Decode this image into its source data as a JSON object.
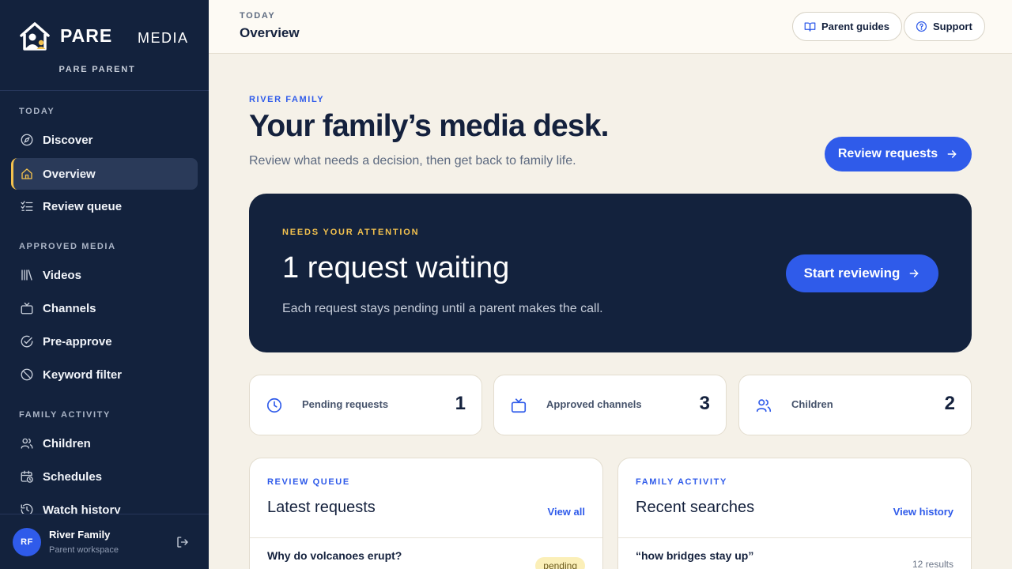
{
  "brand": {
    "name": "PARE",
    "product": "MEDIA",
    "subtitle": "PARE PARENT"
  },
  "sidebar": {
    "sections": [
      {
        "label": "TODAY"
      },
      {
        "label": "APPROVED MEDIA"
      },
      {
        "label": "FAMILY ACTIVITY"
      }
    ],
    "items": [
      {
        "label": "Discover",
        "icon": "compass-icon"
      },
      {
        "label": "Overview",
        "icon": "home-icon",
        "active": true
      },
      {
        "label": "Review queue",
        "icon": "checklist-icon"
      },
      {
        "label": "Videos",
        "icon": "library-icon"
      },
      {
        "label": "Channels",
        "icon": "tv-icon"
      },
      {
        "label": "Pre-approve",
        "icon": "check-circle-icon"
      },
      {
        "label": "Keyword filter",
        "icon": "ban-icon"
      },
      {
        "label": "Children",
        "icon": "users-icon"
      },
      {
        "label": "Schedules",
        "icon": "calendar-clock-icon"
      },
      {
        "label": "Watch history",
        "icon": "history-icon"
      }
    ],
    "user": {
      "initials": "RF",
      "name": "River Family",
      "role": "Parent workspace"
    }
  },
  "topbar": {
    "eyebrow": "TODAY",
    "title": "Overview",
    "buttons": [
      {
        "label": "Parent guides",
        "icon": "book-icon"
      },
      {
        "label": "Support",
        "icon": "help-circle-icon"
      }
    ]
  },
  "hero": {
    "eyebrow": "RIVER FAMILY",
    "title": "Your family’s media desk.",
    "subtitle": "Review what needs a decision, then get back to family life.",
    "cta": "Review requests"
  },
  "attention": {
    "eyebrow": "NEEDS YOUR ATTENTION",
    "title": "1 request waiting",
    "subtitle": "Each request stays pending until a parent makes the call.",
    "cta": "Start reviewing"
  },
  "stats": [
    {
      "label": "Pending requests",
      "value": "1",
      "icon": "clock-icon"
    },
    {
      "label": "Approved channels",
      "value": "3",
      "icon": "tv-icon"
    },
    {
      "label": "Children",
      "value": "2",
      "icon": "users-icon"
    }
  ],
  "panels": {
    "queue": {
      "eyebrow": "REVIEW QUEUE",
      "title": "Latest requests",
      "link": "View all",
      "row": {
        "title": "Why do volcanoes erupt?",
        "status": "pending"
      }
    },
    "activity": {
      "eyebrow": "FAMILY ACTIVITY",
      "title": "Recent searches",
      "link": "View history",
      "row": {
        "title": "“how bridges stay up”",
        "count": "12 results"
      }
    }
  },
  "colors": {
    "navy": "#13223d",
    "accent": "#2f5bea",
    "highlight": "#f2c14e",
    "background": "#f5f1e8"
  }
}
